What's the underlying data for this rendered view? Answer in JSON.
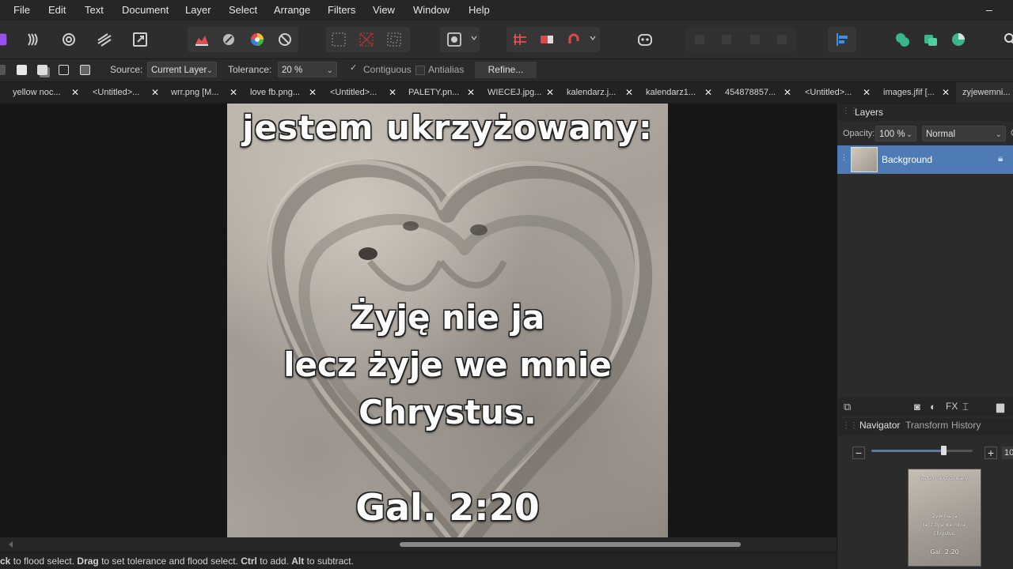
{
  "menu": [
    "File",
    "Edit",
    "Text",
    "Document",
    "Layer",
    "Select",
    "Arrange",
    "Filters",
    "View",
    "Window",
    "Help"
  ],
  "window_controls": {
    "minimize": "–",
    "close": "✕"
  },
  "context_toolbar": {
    "source_label": "Source:",
    "source_value": "Current Layer",
    "tolerance_label": "Tolerance:",
    "tolerance_value": "20 %",
    "contiguous_label": "Contiguous",
    "antialias_label": "Antialias",
    "refine_label": "Refine..."
  },
  "tabs": [
    {
      "label": "yellow noc..."
    },
    {
      "label": "<Untitled>..."
    },
    {
      "label": "wrr.png [M..."
    },
    {
      "label": "love fb.png..."
    },
    {
      "label": "<Untitled>..."
    },
    {
      "label": "PALETY.pn..."
    },
    {
      "label": "WIECEJ.jpg..."
    },
    {
      "label": "kalendarz.j..."
    },
    {
      "label": "kalendarz1..."
    },
    {
      "label": "454878857..."
    },
    {
      "label": "<Untitled>..."
    },
    {
      "label": "images.jfif [..."
    },
    {
      "label": "zyjewemni..."
    }
  ],
  "tab_close": "✕",
  "document": {
    "line1": "jestem ukrzyżowany:",
    "line2": "Żyję nie ja",
    "line3": "lecz żyje we mnie",
    "line4": "Chrystus.",
    "line5": "Gal. 2:20"
  },
  "layers_panel": {
    "title": "Layers",
    "opacity_label": "Opacity:",
    "opacity_value": "100 %",
    "blend_mode": "Normal",
    "layer_name": "Background"
  },
  "navigator_panel": {
    "tabs": [
      "Navigator",
      "Transform",
      "History"
    ],
    "zoom_value": "10"
  },
  "status": {
    "p1": "ck",
    "p2": " to flood select. ",
    "p3": "Drag",
    "p4": " to set tolerance and flood select. ",
    "p5": "Ctrl",
    "p6": " to add. ",
    "p7": "Alt",
    "p8": " to subtract."
  },
  "colors": {
    "accent": "#4e7bb5",
    "canvas_bg": "#161616",
    "panel_bg": "#2b2b2b"
  }
}
